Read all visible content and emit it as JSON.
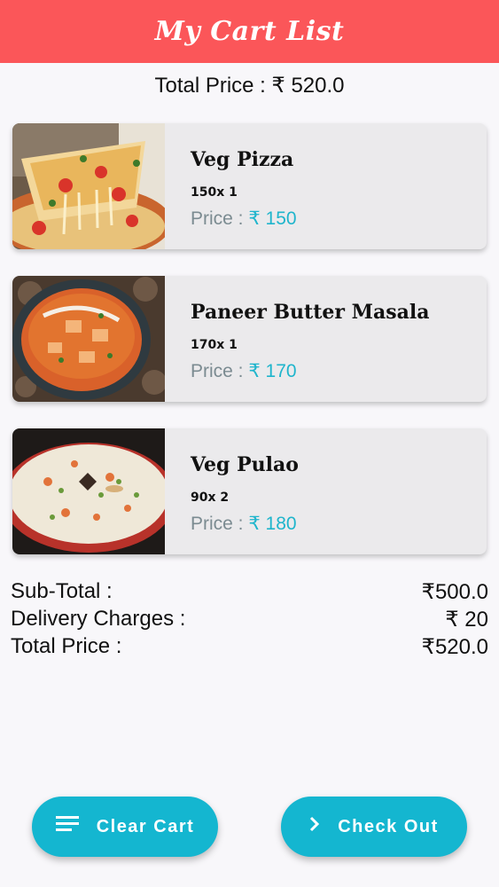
{
  "appbar": {
    "title": "My Cart List"
  },
  "cart": {
    "total_label": "Total Price : ₹ 520.0",
    "items": [
      {
        "name": "Veg Pizza",
        "qty": "150x 1",
        "price_label": "Price : ",
        "price_value": "₹ 150",
        "image_icon": "pizza-photo"
      },
      {
        "name": "Paneer Butter Masala",
        "qty": "170x 1",
        "price_label": "Price : ",
        "price_value": "₹ 170",
        "image_icon": "curry-bowl-photo"
      },
      {
        "name": "Veg Pulao",
        "qty": "90x 2",
        "price_label": "Price : ",
        "price_value": "₹ 180",
        "image_icon": "rice-plate-photo"
      }
    ]
  },
  "summary": {
    "subtotal_label": "Sub-Total :",
    "subtotal_value": "₹500.0",
    "delivery_label": "Delivery Charges :",
    "delivery_value": "₹ 20",
    "total_label": "Total Price :",
    "total_value": "₹520.0"
  },
  "actions": {
    "clear_label": "Clear Cart",
    "clear_icon": "menu-lines-icon",
    "checkout_label": "Check Out",
    "checkout_icon": "chevron-right-icon"
  },
  "colors": {
    "appbar": "#fb5659",
    "accent": "#14b6d0",
    "price": "#1fb5cc"
  }
}
